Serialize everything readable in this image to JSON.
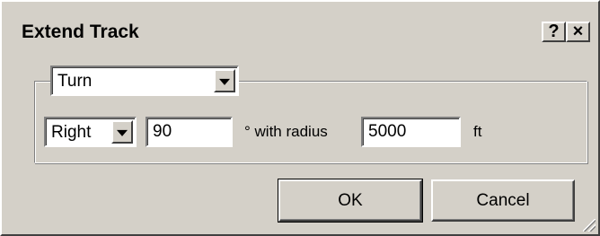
{
  "window": {
    "title": "Extend Track",
    "help_label": "?",
    "close_label": "×"
  },
  "mode_select": {
    "value": "Turn"
  },
  "direction_select": {
    "value": "Right"
  },
  "angle_input": {
    "value": "90"
  },
  "degree_text": "° with radius",
  "radius_input": {
    "value": "5000"
  },
  "unit_text": "ft",
  "buttons": {
    "ok": "OK",
    "cancel": "Cancel"
  }
}
